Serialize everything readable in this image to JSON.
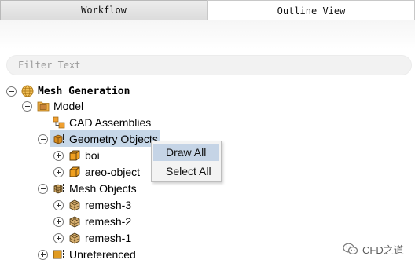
{
  "tabs": [
    {
      "label": "Workflow",
      "active": false
    },
    {
      "label": "Outline View",
      "active": true
    }
  ],
  "filter": {
    "placeholder": "Filter Text",
    "value": ""
  },
  "tree": {
    "root": {
      "label": "Mesh Generation",
      "icon": "globe-icon",
      "expanded": true
    },
    "model": {
      "label": "Model",
      "icon": "folder-icon",
      "expanded": true
    },
    "cad_assemblies": {
      "label": "CAD Assemblies",
      "icon": "cad-assemblies-icon"
    },
    "geometry_objects": {
      "label": "Geometry Objects",
      "icon": "geometry-objects-icon",
      "expanded": true,
      "selected": true
    },
    "geometry_children": [
      {
        "label": "boi",
        "icon": "cube-orange-icon"
      },
      {
        "label": "areo-object",
        "icon": "cube-orange-icon"
      }
    ],
    "mesh_objects": {
      "label": "Mesh Objects",
      "icon": "mesh-objects-icon",
      "expanded": true
    },
    "mesh_children": [
      {
        "label": "remesh-3",
        "icon": "mesh-cube-icon"
      },
      {
        "label": "remesh-2",
        "icon": "mesh-cube-icon"
      },
      {
        "label": "remesh-1",
        "icon": "mesh-cube-icon"
      }
    ],
    "unreferenced": {
      "label": "Unreferenced",
      "icon": "unreferenced-icon",
      "expanded": false
    }
  },
  "context_menu": {
    "items": [
      {
        "label": "Draw All",
        "hover": true
      },
      {
        "label": "Select All",
        "hover": false
      }
    ]
  },
  "watermark": {
    "text": "CFD之道"
  },
  "colors": {
    "selection": "#c6d7e8",
    "menu_hover": "#c5d4e6",
    "folder_orange": "#e8a33a",
    "cube_orange": "#f0a020"
  }
}
